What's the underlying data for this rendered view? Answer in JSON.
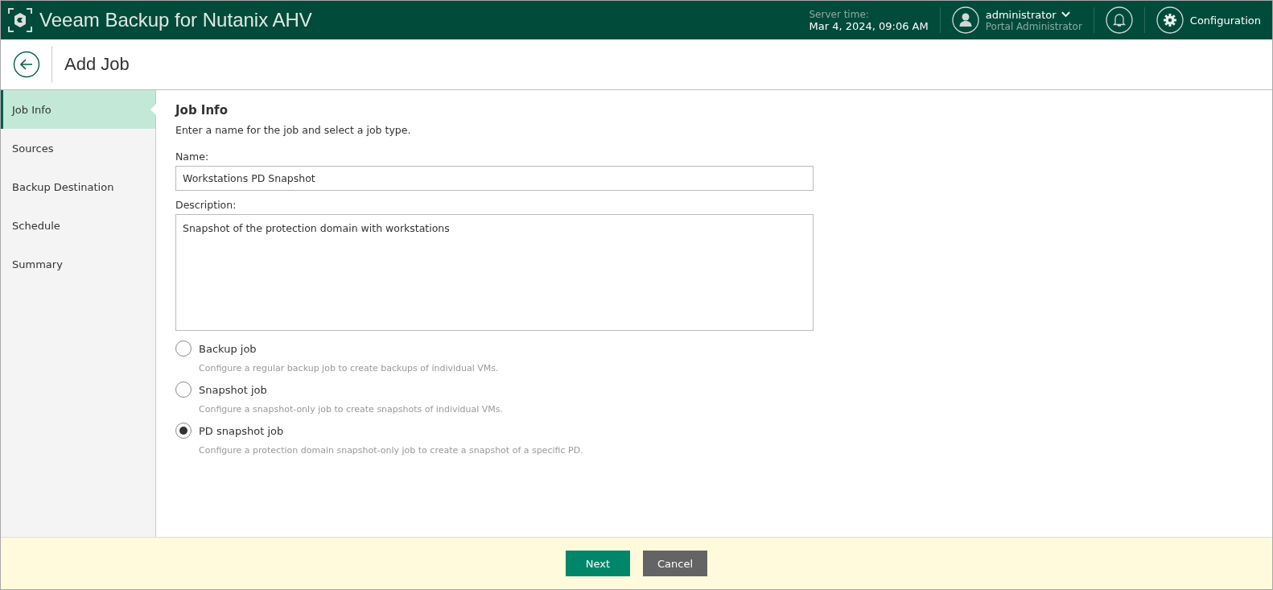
{
  "header": {
    "title": "Veeam Backup for Nutanix AHV",
    "server_time_label": "Server time:",
    "server_time": "Mar 4, 2024, 09:06 AM",
    "user_name": "administrator",
    "user_role": "Portal Administrator",
    "configuration": "Configuration"
  },
  "page_title": "Add Job",
  "steps": [
    {
      "label": "Job Info",
      "selected": true
    },
    {
      "label": "Sources",
      "selected": false
    },
    {
      "label": "Backup Destination",
      "selected": false
    },
    {
      "label": "Schedule",
      "selected": false
    },
    {
      "label": "Summary",
      "selected": false
    }
  ],
  "section": {
    "title": "Job Info",
    "subtitle": "Enter a name for the job and select a job type."
  },
  "name_field": {
    "label": "Name:",
    "value": "Workstations PD Snapshot"
  },
  "description_field": {
    "label": "Description:",
    "value": "Snapshot of the protection domain with workstations"
  },
  "job_types": [
    {
      "label": "Backup job",
      "hint": "Configure a regular backup job to create backups of individual VMs.",
      "selected": false
    },
    {
      "label": "Snapshot job",
      "hint": "Configure a snapshot-only job to create snapshots of individual VMs.",
      "selected": false
    },
    {
      "label": "PD snapshot job",
      "hint": "Configure a protection domain snapshot-only job to create a snapshot of a specific PD.",
      "selected": true
    }
  ],
  "buttons": [
    {
      "label": "Next",
      "kind": "primary"
    },
    {
      "label": "Cancel",
      "kind": "secondary"
    }
  ]
}
